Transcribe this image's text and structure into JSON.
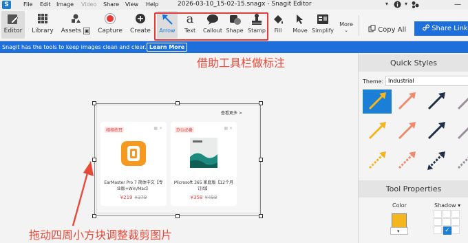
{
  "window": {
    "title": "2026-03-10_15-02-15.snagx - Snagit Editor"
  },
  "menu": {
    "logo": "S",
    "items": [
      {
        "label": "File",
        "disabled": false
      },
      {
        "label": "Edit",
        "disabled": false
      },
      {
        "label": "Image",
        "disabled": false
      },
      {
        "label": "Video",
        "disabled": true
      },
      {
        "label": "Share",
        "disabled": false
      },
      {
        "label": "View",
        "disabled": false
      },
      {
        "label": "Help",
        "disabled": false
      }
    ],
    "right_icons": [
      "chevron-down-icon",
      "info-icon",
      "account-icon",
      "minimize-icon"
    ]
  },
  "toolbar": {
    "left": [
      {
        "label": "Editor",
        "icon": "editor-icon",
        "active": true
      },
      {
        "label": "Library",
        "icon": "library-grid-icon",
        "active": false
      },
      {
        "label": "Assets",
        "icon": "assets-icon",
        "active": false
      },
      {
        "label": "Capture",
        "icon": "capture-record-icon",
        "active": false
      },
      {
        "label": "Create",
        "icon": "create-plus-icon",
        "active": false
      }
    ],
    "tools": [
      {
        "label": "Arrow",
        "icon": "arrow-tool-icon",
        "active": true
      },
      {
        "label": "Text",
        "icon": "text-tool-icon",
        "active": false
      },
      {
        "label": "Callout",
        "icon": "callout-tool-icon",
        "active": false
      },
      {
        "label": "Shape",
        "icon": "shape-tool-icon",
        "active": false
      },
      {
        "label": "Stamp",
        "icon": "stamp-tool-icon",
        "active": false
      },
      {
        "label": "Fill",
        "icon": "fill-tool-icon",
        "active": false
      },
      {
        "label": "Move",
        "icon": "move-tool-icon",
        "active": false
      },
      {
        "label": "Simplify",
        "icon": "simplify-tool-icon",
        "active": false
      },
      {
        "label": "More",
        "icon": "more-chevron-icon",
        "active": false
      }
    ],
    "copy_all": "Copy All",
    "share_link": "Share Link"
  },
  "infobar": {
    "text": "Snagit has the tools to keep images clean and clear.",
    "learn_more": "Learn More"
  },
  "canvas": {
    "annotation_top": "借助工具栏做标注",
    "annotation_bottom": "拖动四周小方块调整裁剪图片",
    "capture": {
      "more_link": "查看更多 >",
      "cards": [
        {
          "tag": "相相练耳",
          "name": "EarMaster Pro 7 简体中文【专业版+Win/Mac】",
          "price": "¥219",
          "old_price": "¥379"
        },
        {
          "tag": "办公必备",
          "name": "Microsoft 365 家庭版【12个月订阅】",
          "price": "¥358",
          "old_price": "¥498"
        }
      ]
    }
  },
  "panel": {
    "quick_styles_title": "Quick Styles",
    "theme_label": "Theme:",
    "theme_value": "Industrial",
    "tool_properties_title": "Tool Properties",
    "color_label": "Color",
    "shadow_label": "Shadow",
    "accent_colors": {
      "selected_bg": "#1b7fd6",
      "yellow": "#f4b61c",
      "salmon": "#ef8a6c",
      "navy": "#1f2f45",
      "gray": "#9a8f9a"
    }
  }
}
